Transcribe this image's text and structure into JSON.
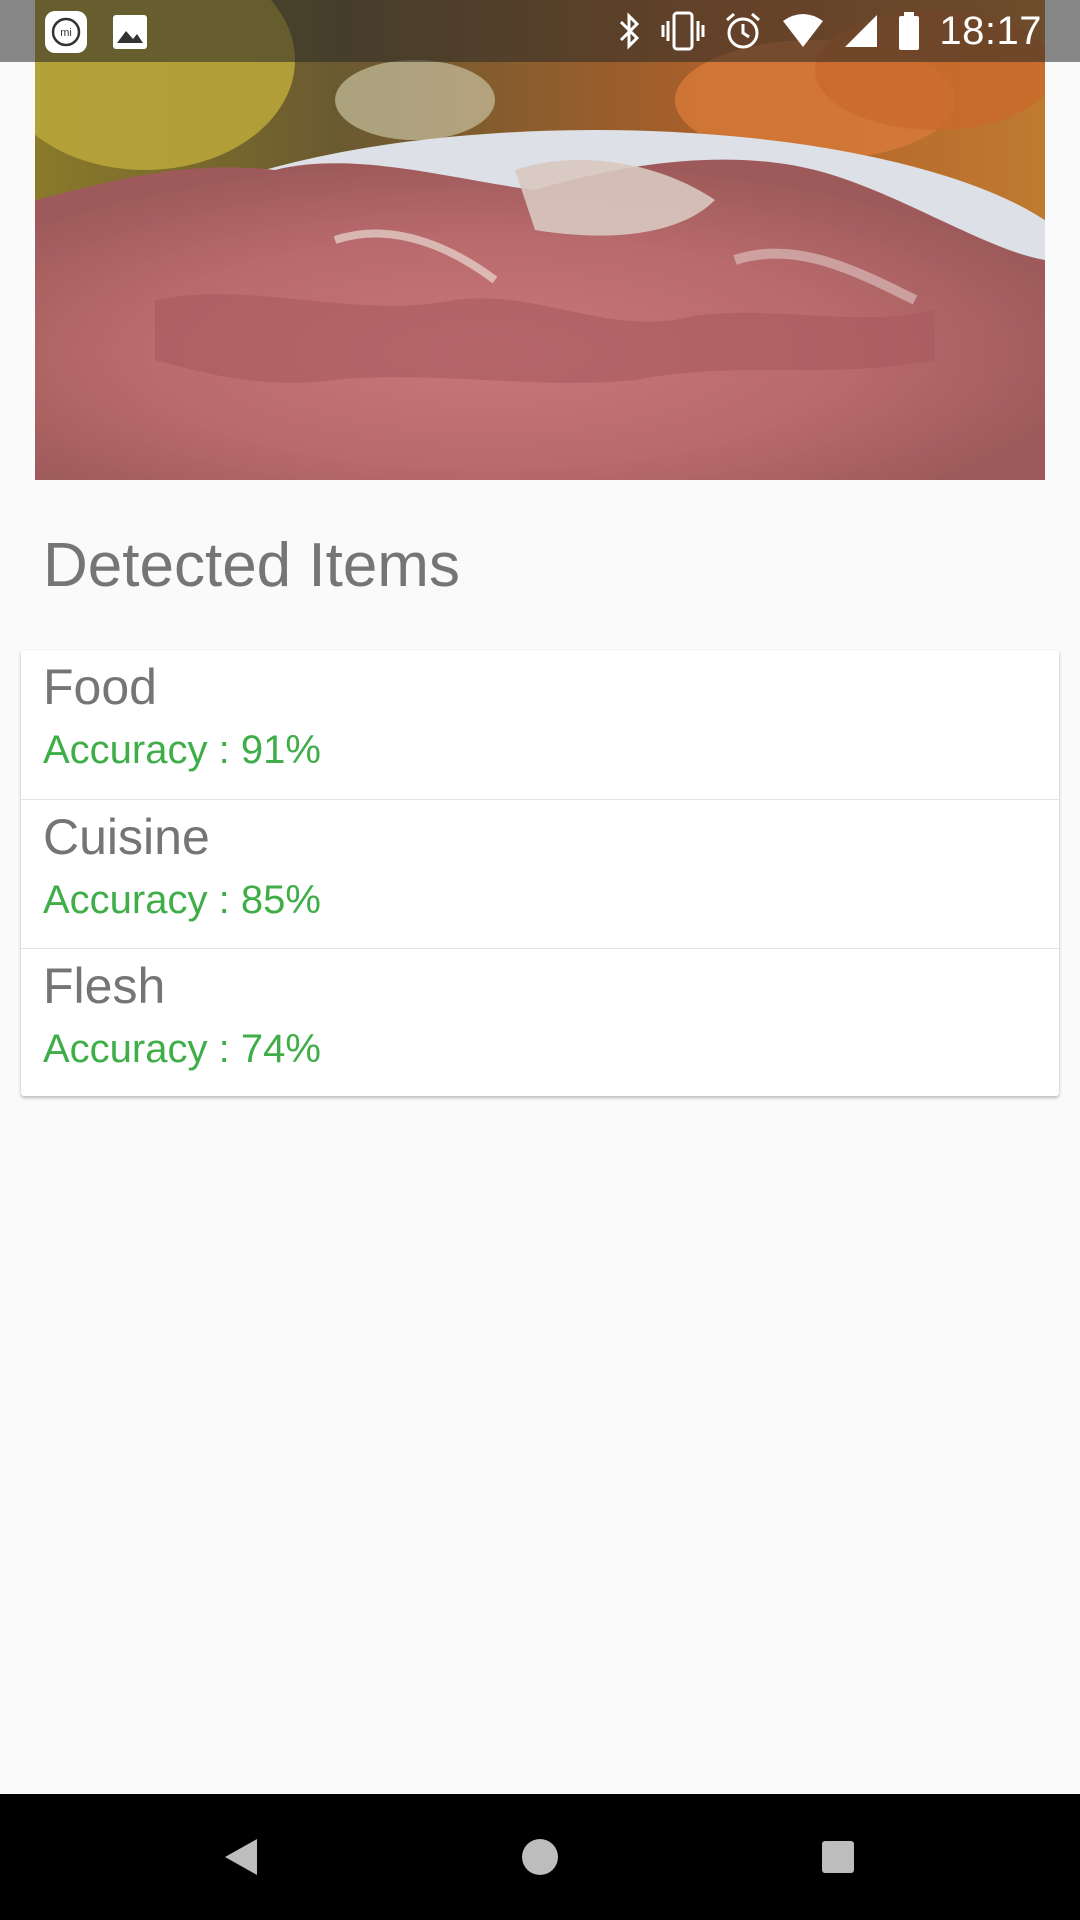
{
  "status_bar": {
    "time": "18:17",
    "left_icons": [
      "mi-app-icon",
      "image-notification-icon"
    ],
    "right_icons": [
      "bluetooth-icon",
      "vibrate-icon",
      "alarm-icon",
      "wifi-icon",
      "signal-icon",
      "battery-icon"
    ]
  },
  "photo": {
    "subject": "food-photo"
  },
  "section": {
    "title": "Detected Items"
  },
  "detected_items": [
    {
      "name": "Food",
      "accuracy": "Accuracy : 91%"
    },
    {
      "name": "Cuisine",
      "accuracy": "Accuracy : 85%"
    },
    {
      "name": "Flesh",
      "accuracy": "Accuracy : 74%"
    }
  ],
  "colors": {
    "accuracy_text": "#3fae49",
    "label_text": "#757575",
    "background": "#fafafa"
  },
  "nav_bar": {
    "buttons": [
      "back-icon",
      "home-icon",
      "recents-icon"
    ]
  }
}
